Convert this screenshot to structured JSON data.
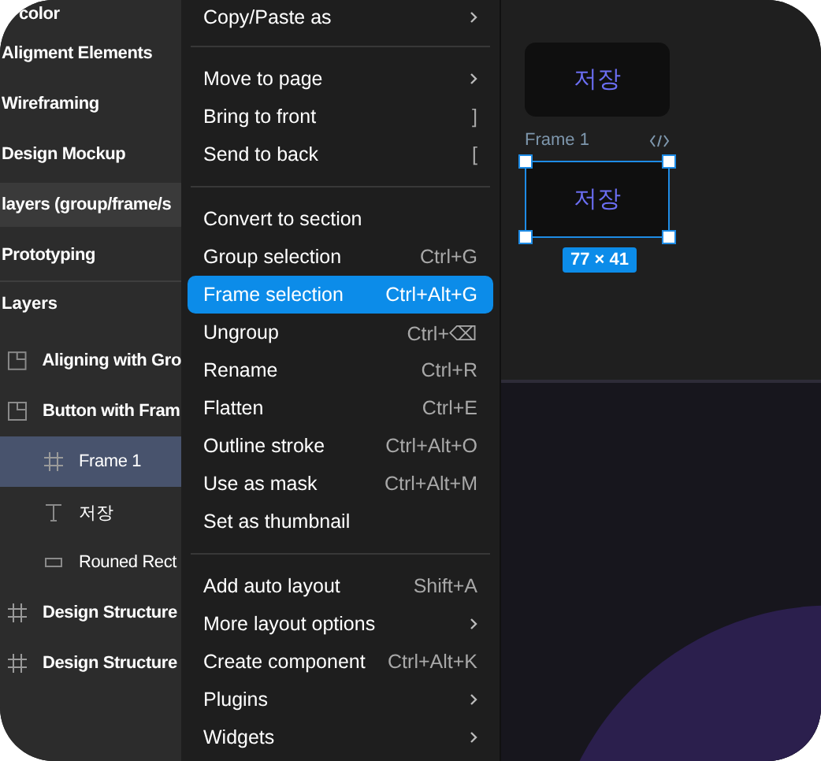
{
  "sidebar": {
    "pages": [
      {
        "label": "color",
        "selected": false
      },
      {
        "label": "Aligment Elements",
        "selected": false
      },
      {
        "label": "Wireframing",
        "selected": false
      },
      {
        "label": "Design Mockup",
        "selected": false
      },
      {
        "label": "layers (group/frame/s",
        "selected": true
      },
      {
        "label": "Prototyping",
        "selected": false
      }
    ],
    "layers_heading": "Layers",
    "layers": [
      {
        "name": "Aligning with Gro",
        "kind": "section",
        "selected": false
      },
      {
        "name": "Button with Fram",
        "kind": "section",
        "selected": false,
        "children": [
          {
            "name": "Frame 1",
            "kind": "frame",
            "selected": true
          },
          {
            "name": "저장",
            "kind": "text",
            "selected": false
          },
          {
            "name": "Rouned Rect",
            "kind": "rect",
            "selected": false
          }
        ]
      },
      {
        "name": "Design Structure",
        "kind": "frame",
        "selected": false
      },
      {
        "name": "Design Structure",
        "kind": "frame",
        "selected": false
      }
    ]
  },
  "context_menu": {
    "sections": [
      [
        {
          "label": "Copy/Paste as",
          "submenu": true,
          "selected": false
        }
      ],
      [
        {
          "label": "Move to page",
          "submenu": true,
          "selected": false
        },
        {
          "label": "Bring to front",
          "shortcut": "]",
          "selected": false
        },
        {
          "label": "Send to back",
          "shortcut": "[",
          "selected": false
        }
      ],
      [
        {
          "label": "Convert to section",
          "selected": false
        },
        {
          "label": "Group selection",
          "shortcut": "Ctrl+G",
          "selected": false
        },
        {
          "label": "Frame selection",
          "shortcut": "Ctrl+Alt+G",
          "selected": true
        },
        {
          "label": "Ungroup",
          "shortcut": "Ctrl+⌫",
          "selected": false
        },
        {
          "label": "Rename",
          "shortcut": "Ctrl+R",
          "selected": false
        },
        {
          "label": "Flatten",
          "shortcut": "Ctrl+E",
          "selected": false
        },
        {
          "label": "Outline stroke",
          "shortcut": "Ctrl+Alt+O",
          "selected": false
        },
        {
          "label": "Use as mask",
          "shortcut": "Ctrl+Alt+M",
          "selected": false
        },
        {
          "label": "Set as thumbnail",
          "selected": false
        }
      ],
      [
        {
          "label": "Add auto layout",
          "shortcut": "Shift+A",
          "selected": false
        },
        {
          "label": "More layout options",
          "submenu": true,
          "selected": false
        },
        {
          "label": "Create component",
          "shortcut": "Ctrl+Alt+K",
          "selected": false
        },
        {
          "label": "Plugins",
          "submenu": true,
          "selected": false
        },
        {
          "label": "Widgets",
          "submenu": true,
          "selected": false
        }
      ]
    ]
  },
  "canvas": {
    "button": {
      "label": "저장"
    },
    "frame": {
      "name": "Frame 1",
      "label": "저장",
      "size": "77 × 41"
    }
  }
}
